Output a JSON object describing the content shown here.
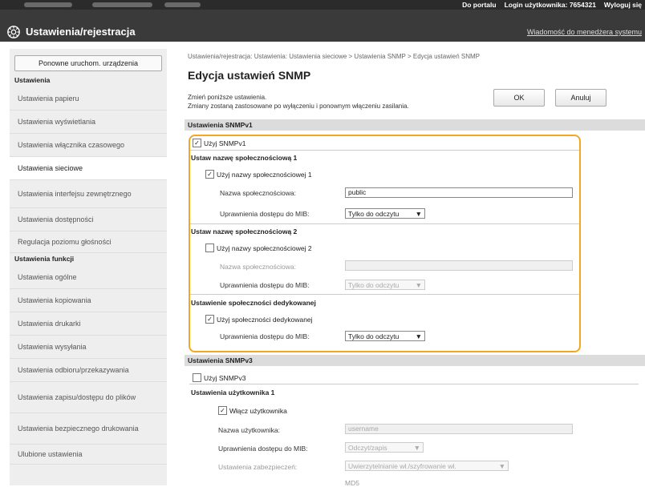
{
  "topbar": {
    "portal_link": "Do portalu",
    "login_label": "Login użytkownika:",
    "login_value": "7654321",
    "logout_link": "Wyloguj się"
  },
  "header": {
    "title": "Ustawienia/rejestracja",
    "message_link": "Wiadomość do menedżera systemu"
  },
  "sidebar": {
    "restart_button": "Ponowne uruchom. urządzenia",
    "section1": "Ustawienia",
    "items1": [
      "Ustawienia papieru",
      "Ustawienia wyświetlania",
      "Ustawienia włącznika czasowego",
      "Ustawienia sieciowe",
      "Ustawienia interfejsu zewnętrznego",
      "Ustawienia dostępności",
      "Regulacja poziomu głośności"
    ],
    "section2": "Ustawienia funkcji",
    "items2": [
      "Ustawienia ogólne",
      "Ustawienia kopiowania",
      "Ustawienia drukarki",
      "Ustawienia wysyłania",
      "Ustawienia odbioru/przekazywania",
      "Ustawienia zapisu/dostępu do plików",
      "Ustawienia bezpiecznego drukowania",
      "Ulubione ustawienia"
    ]
  },
  "main": {
    "breadcrumb": "Ustawienia/rejestracja: Ustawienia: Ustawienia sieciowe > Ustawienia SNMP > Edycja ustawień SNMP",
    "title": "Edycja ustawień SNMP",
    "note_line1": "Zmień poniższe ustawienia.",
    "note_line2": "Zmiany zostaną zastosowane po wyłączeniu i ponownym włączeniu zasilania.",
    "ok_button": "OK",
    "cancel_button": "Anuluj",
    "snmpv1": {
      "header": "Ustawienia SNMPv1",
      "use_snmpv1": "Użyj SNMPv1",
      "use_snmpv1_checked": true,
      "community1": {
        "heading": "Ustaw nazwę społecznościową 1",
        "use_label": "Użyj nazwy społecznościowej 1",
        "checked": true,
        "name_label": "Nazwa społecznościowa:",
        "name_value": "public",
        "mib_label": "Uprawnienia dostępu do MIB:",
        "mib_value": "Tylko do odczytu"
      },
      "community2": {
        "heading": "Ustaw nazwę społecznościową 2",
        "use_label": "Użyj nazwy społecznościowej 2",
        "checked": false,
        "name_label": "Nazwa społecznościowa:",
        "name_value": "",
        "mib_label": "Uprawnienia dostępu do MIB:",
        "mib_value": "Tylko do odczytu"
      },
      "dedicated": {
        "heading": "Ustawienie społeczności dedykowanej",
        "use_label": "Użyj społeczności dedykowanej",
        "checked": true,
        "mib_label": "Uprawnienia dostępu do MIB:",
        "mib_value": "Tylko do odczytu"
      }
    },
    "snmpv3": {
      "header": "Ustawienia SNMPv3",
      "use_snmpv3": "Użyj SNMPv3",
      "use_snmpv3_checked": false,
      "user1": {
        "heading": "Ustawienia użytkownika 1",
        "enable_label": "Włącz użytkownika",
        "checked": true,
        "username_label": "Nazwa użytkownika:",
        "username_value": "username",
        "mib_label": "Uprawnienia dostępu do MIB:",
        "mib_value": "Odczyt/zapis",
        "security_label": "Ustawienia zabezpieczeń:",
        "security_value": "Uwierzytelnianie wł./szyfrowanie wł.",
        "algorithm_value": "MD5"
      }
    }
  },
  "colors": {
    "highlight": "#f5a623",
    "header_bg": "#3a3a3a",
    "band_bg": "#dcdcdc"
  }
}
